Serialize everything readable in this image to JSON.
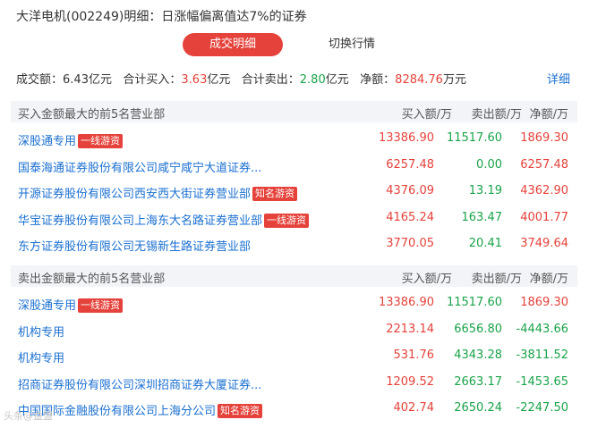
{
  "title": "大洋电机(002249)明细：日涨幅偏离值达7%的证券",
  "tabs": {
    "active": "成交明细",
    "other": "切换行情"
  },
  "summary": {
    "volume_label": "成交额：",
    "volume_value": "6.43亿元",
    "buy_label": "合计买入：",
    "buy_value": "3.63",
    "buy_unit": "亿元",
    "sell_label": "合计卖出：",
    "sell_value": "2.80",
    "sell_unit": "亿元",
    "net_label": "净额：",
    "net_value": "8284.76",
    "net_unit": "万元",
    "detail_link": "详细"
  },
  "buy_section": {
    "title": "买入金额最大的前5名营业部",
    "col_buy": "买入额/万",
    "col_sell": "卖出额/万",
    "col_net": "净额/万",
    "rows": [
      {
        "name": "深股通专用",
        "badge": "一线游资",
        "buy": "13386.90",
        "sell": "11517.60",
        "net": "1869.30"
      },
      {
        "name": "国泰海通证券股份有限公司咸宁咸宁大道证券...",
        "badge": "",
        "buy": "6257.48",
        "sell": "0.00",
        "net": "6257.48"
      },
      {
        "name": "开源证券股份有限公司西安西大街证券营业部",
        "badge": "知名游资",
        "buy": "4376.09",
        "sell": "13.19",
        "net": "4362.90"
      },
      {
        "name": "华宝证券股份有限公司上海东大名路证券营业部",
        "badge": "一线游资",
        "buy": "4165.24",
        "sell": "163.47",
        "net": "4001.77"
      },
      {
        "name": "东方证券股份有限公司无锡新生路证券营业部",
        "badge": "",
        "buy": "3770.05",
        "sell": "20.41",
        "net": "3749.64"
      }
    ]
  },
  "sell_section": {
    "title": "卖出金额最大的前5名营业部",
    "col_buy": "买入额/万",
    "col_sell": "卖出额/万",
    "col_net": "净额/万",
    "rows": [
      {
        "name": "深股通专用",
        "badge": "一线游资",
        "buy": "13386.90",
        "sell": "11517.60",
        "net": "1869.30"
      },
      {
        "name": "机构专用",
        "badge": "",
        "buy": "2213.14",
        "sell": "6656.80",
        "net": "-4443.66"
      },
      {
        "name": "机构专用",
        "badge": "",
        "buy": "531.76",
        "sell": "4343.28",
        "net": "-3811.52"
      },
      {
        "name": "招商证券股份有限公司深圳招商证券大厦证券...",
        "badge": "",
        "buy": "1209.52",
        "sell": "2663.17",
        "net": "-1453.65"
      },
      {
        "name": "中国国际金融股份有限公司上海分公司",
        "badge": "知名游资",
        "buy": "402.74",
        "sell": "2650.24",
        "net": "-2247.50"
      }
    ]
  },
  "watermark": "头条@益盟",
  "colors": {
    "accent_red": "#e5423b",
    "green": "#1aa34a",
    "link_blue": "#1a6fd0",
    "header_bg": "#f2f4f8"
  }
}
